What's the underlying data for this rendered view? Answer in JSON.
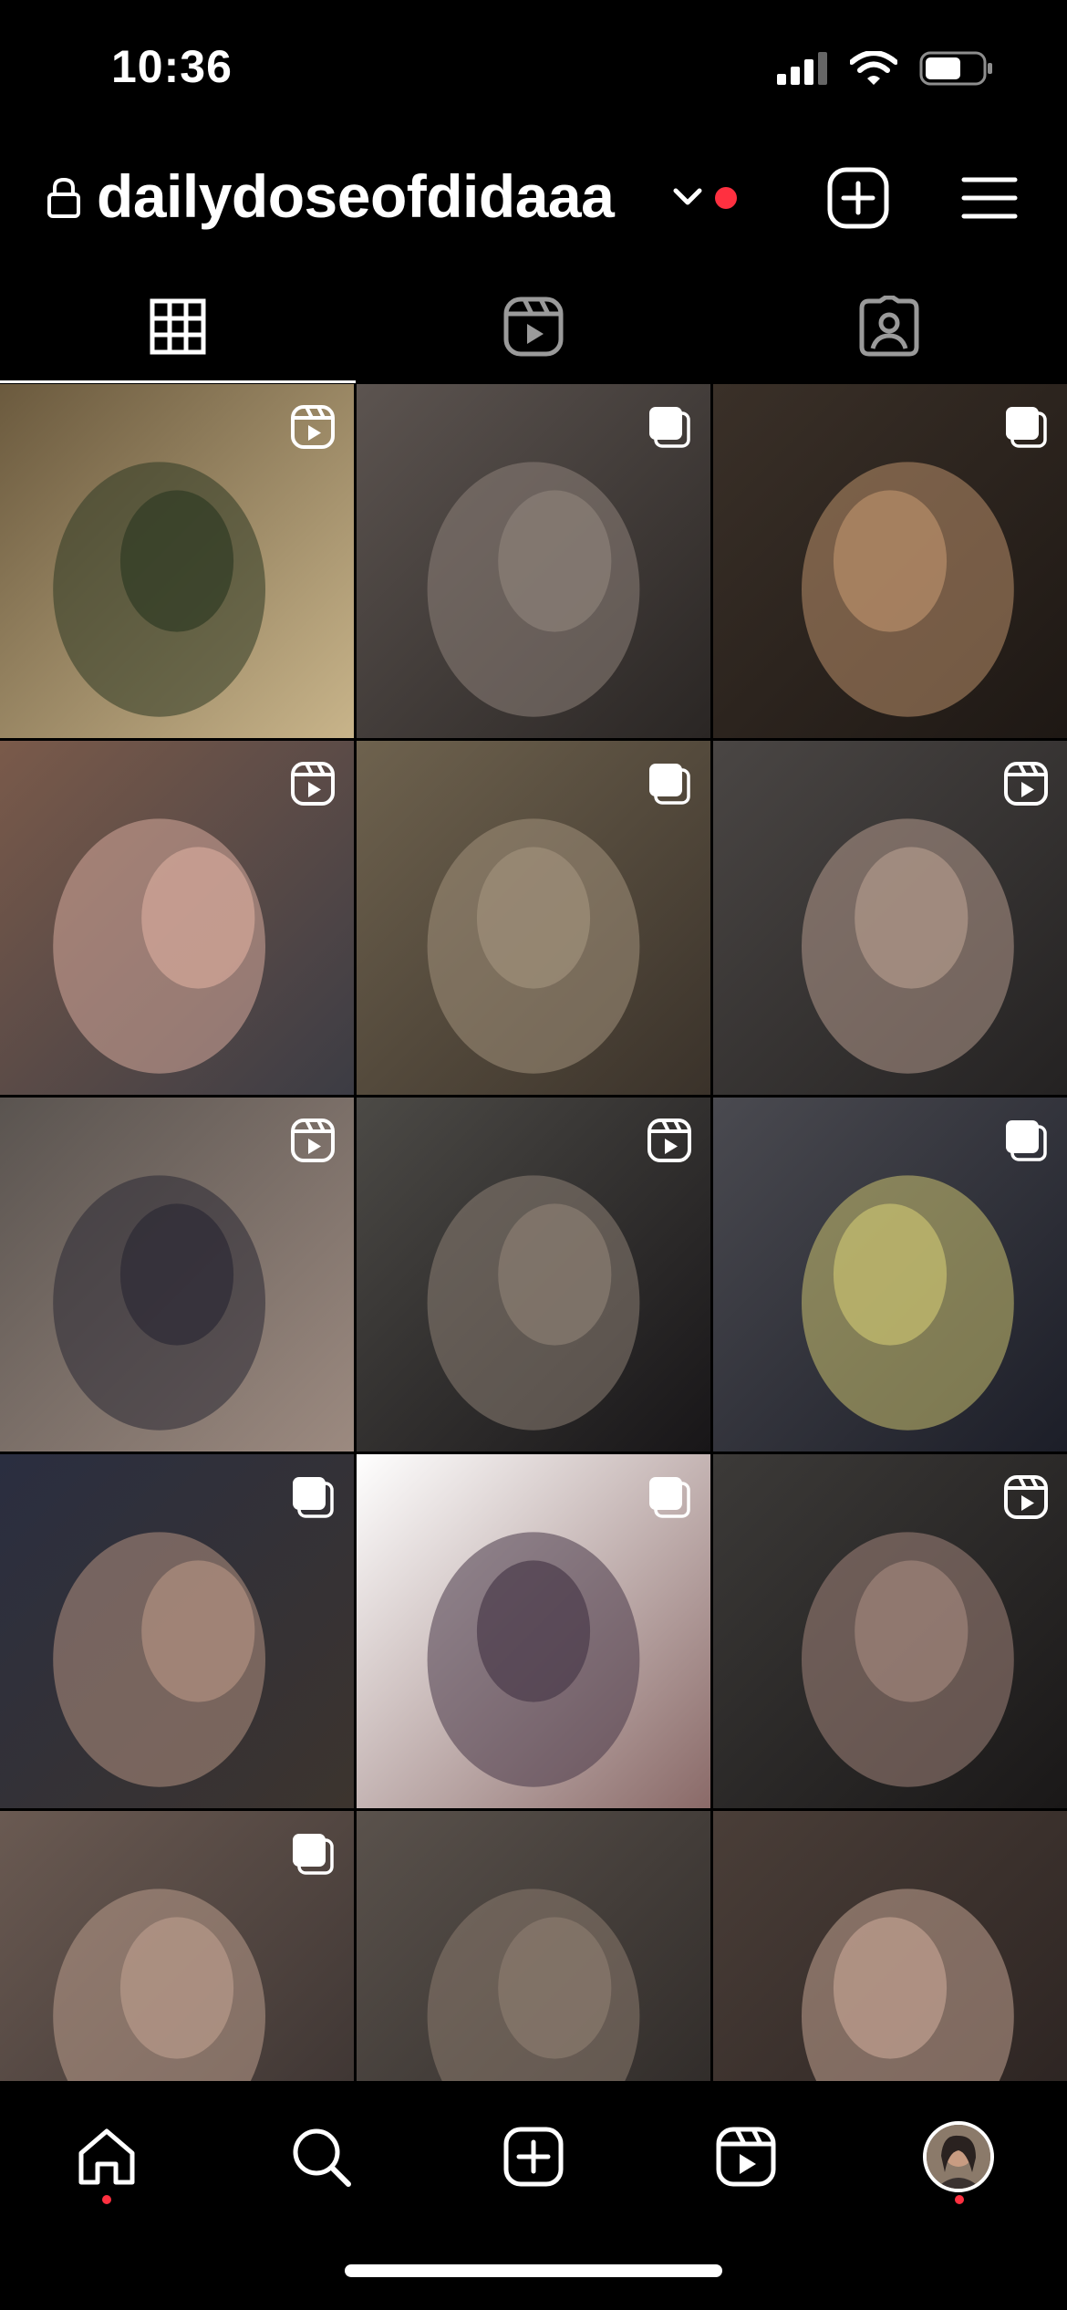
{
  "status_bar": {
    "time": "10:36",
    "icons": [
      "signal-icon",
      "wifi-icon",
      "battery-icon"
    ]
  },
  "header": {
    "username": "dailydoseofdidaaa",
    "icons": [
      "lock-icon",
      "chevron-down-icon",
      "new-post-icon",
      "menu-icon"
    ],
    "notification_color": "#ff3040"
  },
  "tabs": [
    {
      "name": "posts-grid",
      "icon": "grid-icon",
      "active": true
    },
    {
      "name": "reels",
      "icon": "reels-icon",
      "active": false
    },
    {
      "name": "tagged",
      "icon": "tagged-icon",
      "active": false
    }
  ],
  "grid": {
    "posts": [
      {
        "type": "reel",
        "colors": [
          "#6b5a3e",
          "#2f3a24",
          "#c8b48a"
        ]
      },
      {
        "type": "carousel",
        "colors": [
          "#5c5450",
          "#8c8078",
          "#2a2624"
        ]
      },
      {
        "type": "carousel",
        "colors": [
          "#3a3028",
          "#b88e6a",
          "#1e1814"
        ]
      },
      {
        "type": "reel",
        "colors": [
          "#7a5a4a",
          "#d4a89a",
          "#3c3c44"
        ]
      },
      {
        "type": "carousel",
        "colors": [
          "#6e624e",
          "#a0907a",
          "#3a322a"
        ]
      },
      {
        "type": "reel",
        "colors": [
          "#4a4644",
          "#b0988a",
          "#242222"
        ]
      },
      {
        "type": "reel",
        "colors": [
          "#5a5450",
          "#2c2a34",
          "#9c8a80"
        ]
      },
      {
        "type": "reel",
        "colors": [
          "#4c4a46",
          "#8a7e72",
          "#181618"
        ]
      },
      {
        "type": "carousel",
        "colors": [
          "#4a4a50",
          "#c8c070",
          "#1c1e28"
        ]
      },
      {
        "type": "carousel",
        "colors": [
          "#2a2e40",
          "#b09080",
          "#3c342e"
        ]
      },
      {
        "type": "carousel",
        "colors": [
          "#ffffff",
          "#4a3a4a",
          "#8a6a68"
        ]
      },
      {
        "type": "reel",
        "colors": [
          "#3c3a38",
          "#a0847a",
          "#1a1818"
        ]
      },
      {
        "type": "carousel",
        "colors": [
          "#6a5a52",
          "#b89a8a",
          "#3a3230"
        ]
      },
      {
        "type": "none",
        "colors": [
          "#5a524c",
          "#8a7a6e",
          "#2c2826"
        ]
      },
      {
        "type": "none",
        "colors": [
          "#4a3e38",
          "#c0a090",
          "#2a2220"
        ]
      }
    ]
  },
  "bottom_nav": {
    "items": [
      "home-icon",
      "search-icon",
      "create-icon",
      "reels-icon",
      "profile-avatar"
    ],
    "notification_color": "#ff3040"
  }
}
